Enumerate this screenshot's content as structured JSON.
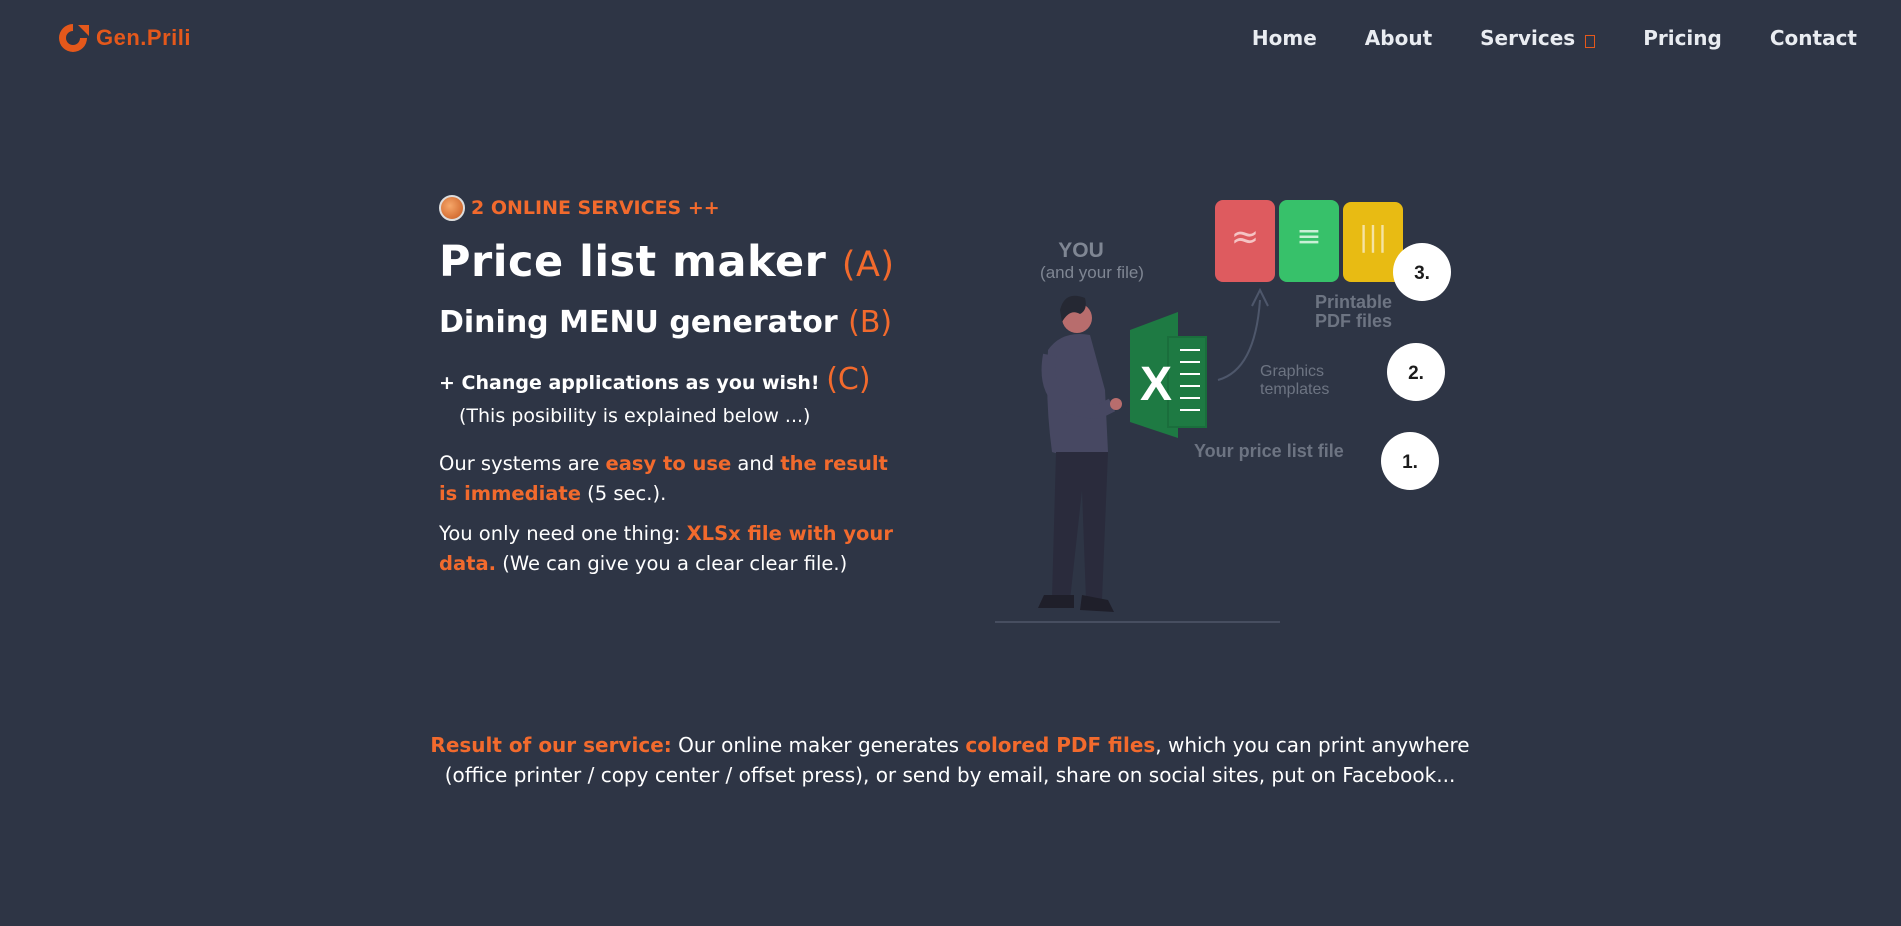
{
  "brand": {
    "name": "Gen.Prili"
  },
  "nav": {
    "items": [
      {
        "label": "Home"
      },
      {
        "label": "About"
      },
      {
        "label": "Services"
      },
      {
        "label": "Pricing"
      },
      {
        "label": "Contact"
      }
    ]
  },
  "hero": {
    "kicker": "2 ONLINE SERVICES ++",
    "title": "Price list maker",
    "title_tag": "(A)",
    "subtitle": "Dining MENU generator",
    "subtitle_tag": "(B)",
    "change": "+ Change applications as you wish!",
    "change_tag": "(C)",
    "change_note": "(This posibility is explained below ...)",
    "p1": {
      "a": "Our systems are ",
      "b": "easy to use",
      "c": " and ",
      "d": "the result is immediate",
      "e": " (5 sec.)."
    },
    "p2": {
      "a": "You only need one thing: ",
      "b": "XLSx file with your data.",
      "c": " (We can give you a clear clear file.)"
    }
  },
  "illustration": {
    "you": "YOU",
    "you_sub": "(and your file)",
    "step3": "3.",
    "step2": "2.",
    "step1": "1.",
    "printable": "Printable",
    "pdf_files": "PDF files",
    "graphics": "Graphics",
    "templates": "templates",
    "price_file": "Your price list file",
    "excel_letter": "X",
    "card_colors": [
      "#de5b5f",
      "#37c16a",
      "#e8bb13"
    ]
  },
  "result": {
    "a": "Result of our service:",
    "b": " Our online maker generates ",
    "c": "colored PDF files",
    "d": ", which you can print anywhere (office printer / copy center / offset press), or send by email, share on social sites, put on Facebook..."
  }
}
